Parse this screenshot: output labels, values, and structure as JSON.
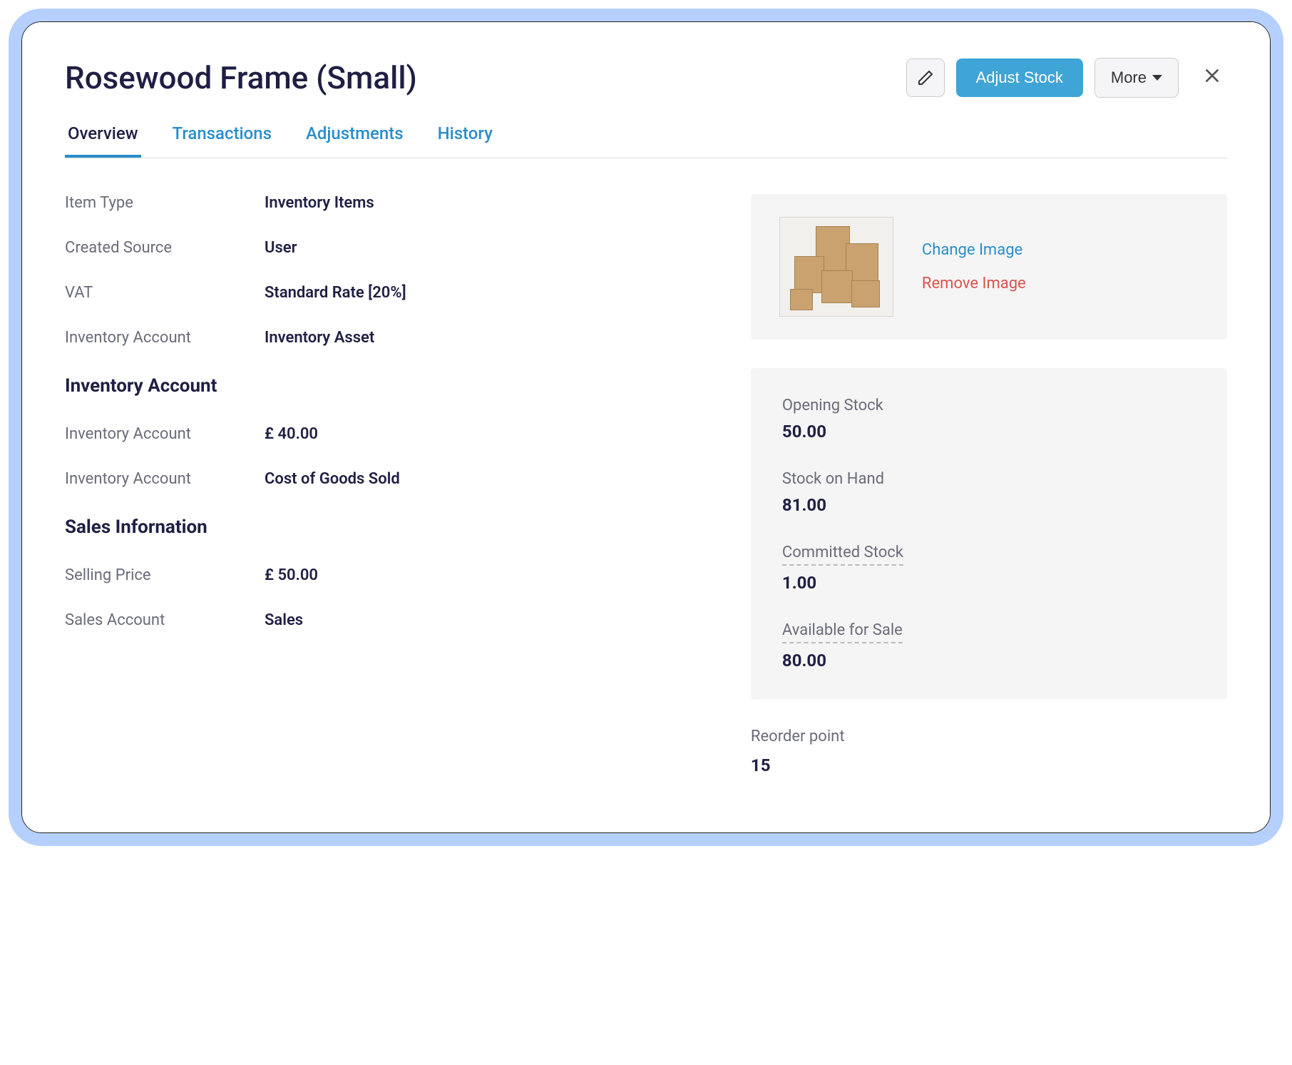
{
  "header": {
    "title": "Rosewood Frame (Small)",
    "adjust_stock_label": "Adjust Stock",
    "more_label": "More"
  },
  "tabs": {
    "overview": "Overview",
    "transactions": "Transactions",
    "adjustments": "Adjustments",
    "history": "History"
  },
  "general": {
    "item_type_label": "Item Type",
    "item_type_value": "Inventory Items",
    "created_source_label": "Created Source",
    "created_source_value": "User",
    "vat_label": "VAT",
    "vat_value": "Standard Rate [20%]",
    "inventory_account_label": "Inventory Account",
    "inventory_account_value": "Inventory Asset"
  },
  "inventory_section": {
    "heading": "Inventory Account",
    "row1_label": "Inventory Account",
    "row1_value": "£ 40.00",
    "row2_label": "Inventory Account",
    "row2_value": "Cost of Goods Sold"
  },
  "sales_section": {
    "heading": "Sales Infornation",
    "selling_price_label": "Selling Price",
    "selling_price_value": "£ 50.00",
    "sales_account_label": "Sales Account",
    "sales_account_value": "Sales"
  },
  "image_actions": {
    "change": "Change Image",
    "remove": "Remove Image"
  },
  "stock": {
    "opening_label": "Opening Stock",
    "opening_value": "50.00",
    "on_hand_label": "Stock on Hand",
    "on_hand_value": "81.00",
    "committed_label": "Committed Stock",
    "committed_value": "1.00",
    "available_label": "Available for Sale",
    "available_value": "80.00"
  },
  "reorder": {
    "label": "Reorder point",
    "value": "15"
  }
}
